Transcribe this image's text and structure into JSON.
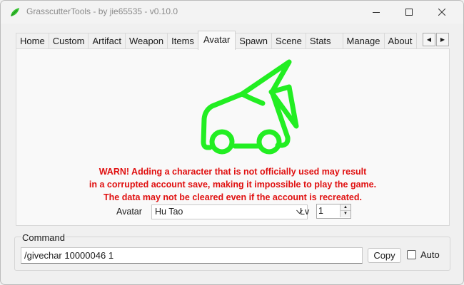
{
  "window": {
    "title": "GrasscutterTools  - by jie65535  - v0.10.0"
  },
  "tabs": [
    {
      "label": "Home"
    },
    {
      "label": "Custom"
    },
    {
      "label": "Artifact"
    },
    {
      "label": "Weapon"
    },
    {
      "label": "Items"
    },
    {
      "label": "Avatar"
    },
    {
      "label": "Spawn"
    },
    {
      "label": "Scene"
    },
    {
      "label": "Stats"
    },
    {
      "label": "Manage"
    },
    {
      "label": "About"
    }
  ],
  "active_tab": "Avatar",
  "avatar_page": {
    "icon": "car-icon",
    "icon_color": "#22ee22",
    "warning_color": "#e01010",
    "warning_lines": [
      "WARN! Adding a character that is not officially used may result",
      "in a corrupted account save, making it impossible to play the game.",
      "The data may not be cleared even if the account is recreated."
    ],
    "avatar_label": "Avatar",
    "avatar_value": "Hu Tao",
    "lv_label": "Lv",
    "lv_value": "1"
  },
  "command": {
    "legend": "Command",
    "value": "/givechar 10000046 1",
    "copy_label": "Copy",
    "auto_label": "Auto",
    "auto_checked": false
  }
}
